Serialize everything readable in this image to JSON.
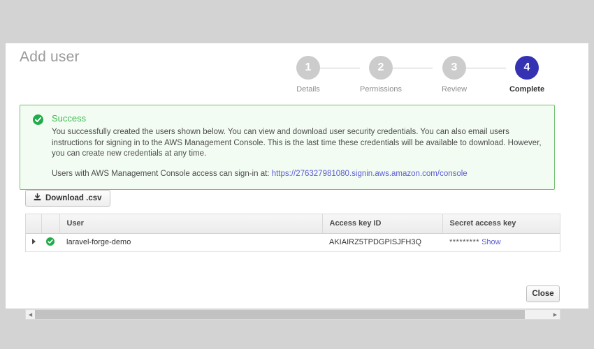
{
  "page": {
    "title": "Add user",
    "background_color": "#d3d3d3",
    "card_color": "#ffffff"
  },
  "wizard": {
    "active_color": "#3432b3",
    "inactive_color": "#cccccc",
    "steps": [
      {
        "number": "1",
        "label": "Details"
      },
      {
        "number": "2",
        "label": "Permissions"
      },
      {
        "number": "3",
        "label": "Review"
      },
      {
        "number": "4",
        "label": "Complete"
      }
    ]
  },
  "alert": {
    "icon": "check-circle-icon",
    "title": "Success",
    "border_color": "#74c274",
    "background_color": "#f3fcf3",
    "title_color": "#3fbb52",
    "paragraph1": "You successfully created the users shown below. You can view and download user security credentials. You can also email users instructions for signing in to the AWS Management Console. This is the last time these credentials will be available to download. However, you can create new credentials at any time.",
    "paragraph2_prefix": "Users with AWS Management Console access can sign-in at: ",
    "signin_url": "https://276327981080.signin.aws.amazon.com/console",
    "link_color": "#5b5bd6"
  },
  "toolbar": {
    "download_icon": "download-icon",
    "download_label": "Download .csv"
  },
  "table": {
    "columns": [
      {
        "key": "toggle",
        "label": ""
      },
      {
        "key": "status",
        "label": ""
      },
      {
        "key": "user",
        "label": "User"
      },
      {
        "key": "access_key_id",
        "label": "Access key ID"
      },
      {
        "key": "secret_access_key",
        "label": "Secret access key"
      }
    ],
    "rows": [
      {
        "toggle_icon": "expand-triangle-icon",
        "status_icon": "check-circle-icon",
        "user": "laravel-forge-demo",
        "access_key_id": "AKIAIRZ5TPDGPISJFH3Q",
        "secret_masked": "*********",
        "secret_show_label": "Show"
      }
    ]
  },
  "scrollbar": {
    "left_arrow_icon": "caret-left-icon",
    "right_arrow_icon": "caret-right-icon",
    "thumb_percent": "95"
  },
  "footer": {
    "close_label": "Close"
  }
}
